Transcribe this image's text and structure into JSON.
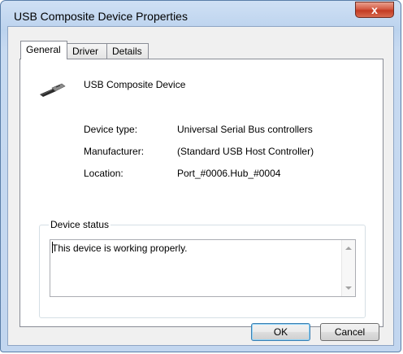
{
  "window": {
    "title": "USB Composite Device Properties",
    "close_label": "x"
  },
  "tabs": [
    {
      "label": "General",
      "active": true
    },
    {
      "label": "Driver",
      "active": false
    },
    {
      "label": "Details",
      "active": false
    }
  ],
  "general": {
    "device_icon": "usb-connector-icon",
    "device_name": "USB Composite Device",
    "properties": [
      {
        "label": "Device type:",
        "value": "Universal Serial Bus controllers"
      },
      {
        "label": "Manufacturer:",
        "value": "(Standard USB Host Controller)"
      },
      {
        "label": "Location:",
        "value": "Port_#0006.Hub_#0004"
      }
    ],
    "status": {
      "title": "Device status",
      "text": "This device is working properly."
    }
  },
  "buttons": {
    "ok": "OK",
    "cancel": "Cancel"
  },
  "colors": {
    "title_bar": "#c4d9f1",
    "close_button": "#c9442b",
    "dialog_bg": "#f0f0f0"
  }
}
